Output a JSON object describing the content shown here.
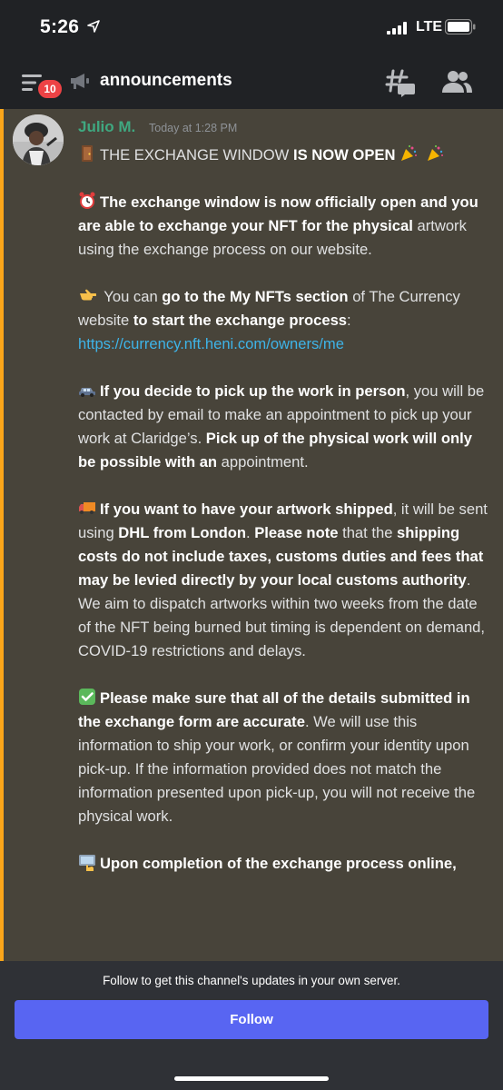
{
  "status_bar": {
    "time": "5:26",
    "network": "LTE"
  },
  "header": {
    "notification_count": "10",
    "channel_name": "announcements",
    "icons": [
      "hamburger-menu-icon",
      "megaphone-icon",
      "threads-icon",
      "members-icon"
    ]
  },
  "message": {
    "author": "Julio M.",
    "timestamp": "Today at 1:28 PM",
    "paragraphs": {
      "p1": {
        "emoji1": "door-emoji",
        "text1": "THE EXCHANGE WINDOW ",
        "bold1": "IS NOW OPEN",
        "emoji2": "party-popper-emoji",
        "emoji3": "party-popper-emoji"
      },
      "p2": {
        "emoji": "alarm-clock-emoji",
        "bold1": "The exchange window is now officially open and you are able to exchange your NFT for the physical",
        "text1": " artwork using the exchange process on our website."
      },
      "p3": {
        "emoji": "pointing-right-emoji",
        "text1": " You can ",
        "bold1": "go to the My NFTs section",
        "text2": " of The Currency website ",
        "bold2": "to start the exchange process",
        "text3": ":",
        "link": "https://currency.nft.heni.com/owners/me"
      },
      "p4": {
        "emoji": "car-emoji",
        "bold1": "If you decide to pick up the work in person",
        "text1": ", you will be contacted by email to make an appointment to pick up your work at Claridge’s. ",
        "bold2": "Pick up of the physical work will only be possible with an",
        "text2": " appointment."
      },
      "p5": {
        "emoji": "truck-emoji",
        "bold1": "If you want to have your artwork shipped",
        "text1": ", it will be sent using ",
        "bold2": "DHL from London",
        "text2": ". ",
        "bold3": "Please note",
        "text3": " that the ",
        "bold4": "shipping costs do not include taxes, customs duties and fees that may be levied directly by your local customs authority",
        "text4": ". We aim to dispatch artworks within two weeks from the date of the NFT being burned but timing is dependent on demand, COVID-19 restrictions and delays."
      },
      "p6": {
        "emoji": "check-mark-emoji",
        "bold1": "Please make sure that all of the details submitted in the exchange form are accurate",
        "text1": ". We will use this information to ship your work, or confirm your identity upon pick-up. If the information provided does not match the information presented upon pick-up, you will not receive the physical work."
      },
      "p7": {
        "emoji": "computer-hand-emoji",
        "bold1": "Upon completion of the exchange process online,"
      }
    }
  },
  "footer": {
    "note": "Follow to get this channel's updates in your own server.",
    "follow_label": "Follow"
  },
  "colors": {
    "header_bg": "#202225",
    "message_highlight_bg": "#48443a",
    "mention_bar": "#faa61a",
    "author_color": "#3fa880",
    "link_color": "#3eb4e8",
    "follow_button": "#5865f2",
    "badge": "#ed4245"
  }
}
